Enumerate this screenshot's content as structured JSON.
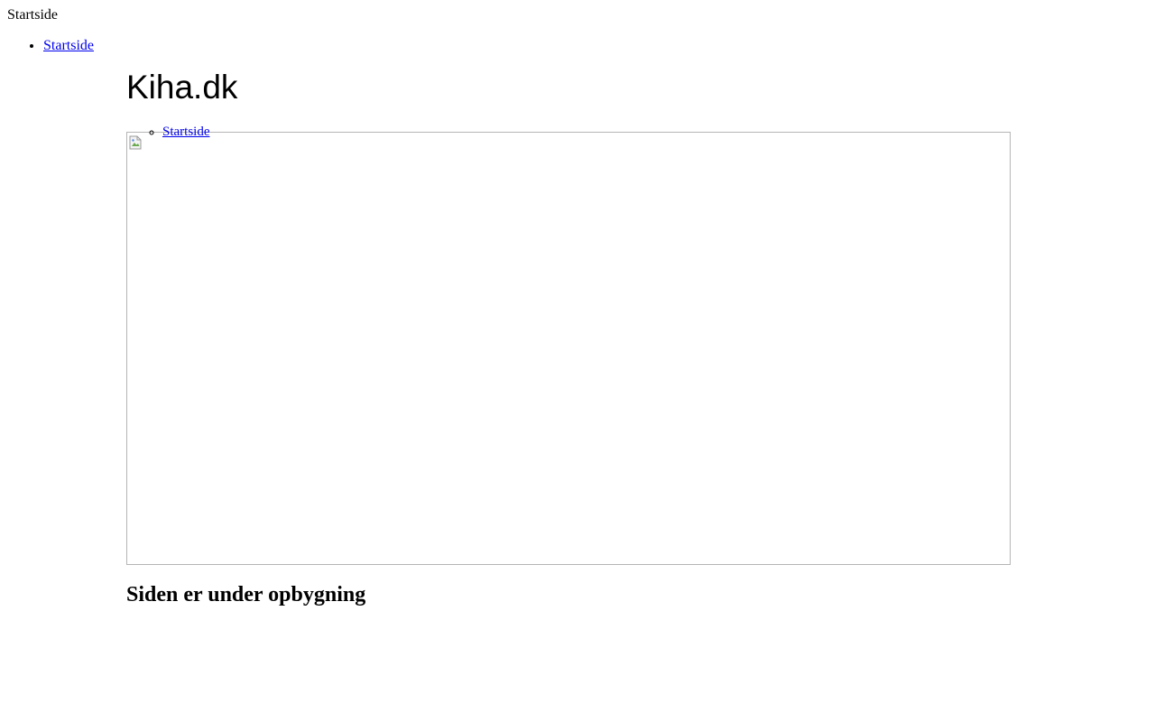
{
  "header": {
    "label": "Startside",
    "nav_items": [
      {
        "label": "Startside"
      }
    ]
  },
  "main": {
    "title": "Kiha.dk",
    "nav_items": [
      {
        "label": "Startside"
      }
    ],
    "hero_image": {
      "icon": "broken-image-icon",
      "border_color": "#b5b5b5"
    },
    "status": "Siden er under opbygning"
  },
  "colors": {
    "link": "#0000ee",
    "text": "#000000",
    "background": "#ffffff"
  }
}
